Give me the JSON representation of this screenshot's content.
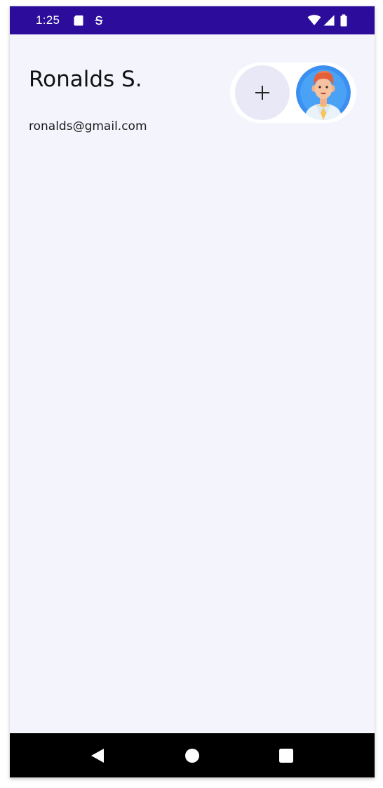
{
  "status_bar": {
    "time": "1:25",
    "background": "#2c0d9b",
    "icons": [
      "sd-card-icon",
      "sync-s-icon",
      "wifi-icon",
      "signal-icon",
      "battery-icon"
    ]
  },
  "profile": {
    "name": "Ronalds S.",
    "email": "ronalds@gmail.com"
  },
  "actions": {
    "add_icon": "plus-icon",
    "avatar": "doctor-avatar-icon"
  },
  "nav_bar": {
    "buttons": [
      "back-icon",
      "home-icon",
      "recents-icon"
    ]
  },
  "colors": {
    "status_bar": "#2c0d9b",
    "page_background": "#f4f4fd",
    "add_button": "#e9e8f6",
    "avatar_ring": "#3b8ff0"
  }
}
